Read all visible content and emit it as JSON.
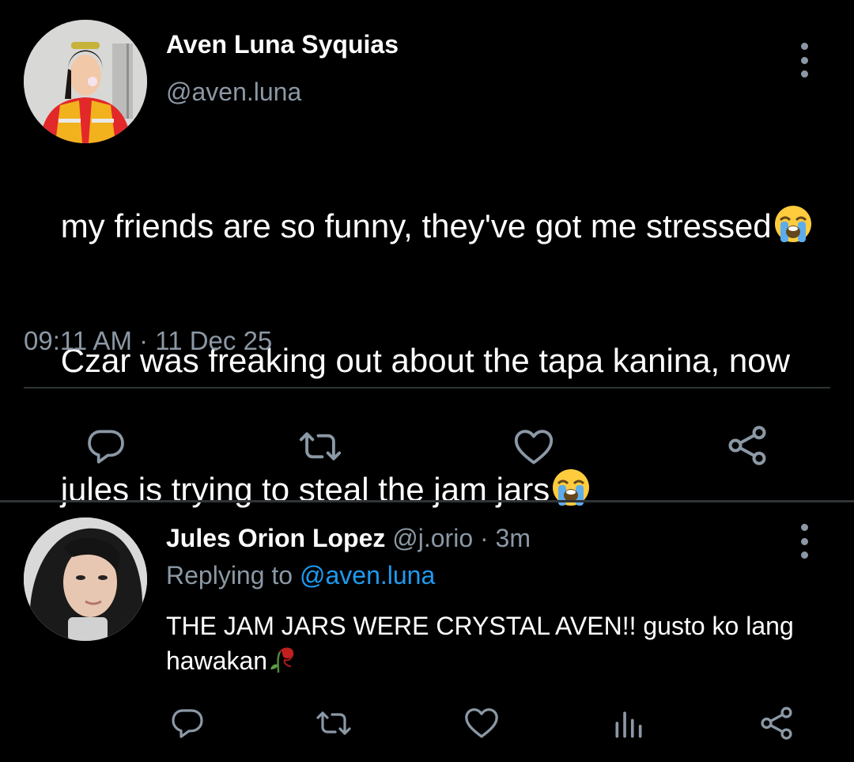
{
  "tweet": {
    "author_name": "Aven Luna Syquias",
    "author_handle": "@aven.luna",
    "line1": "my friends are so funny, they've got me stressed",
    "line2": "Czar was freaking out about the tapa kanina, now",
    "line3": "jules is trying to steal the jam jars",
    "emoji": "loudly-crying-face",
    "timestamp": "09:11 AM · 11 Dec 25"
  },
  "tweet_actions": [
    "reply-icon",
    "retweet-icon",
    "like-icon",
    "share-icon"
  ],
  "reply": {
    "author_name": "Jules Orion Lopez",
    "meta": "@j.orio · 3m",
    "replying_prefix": "Replying to",
    "replying_mention": "@aven.luna",
    "text": "THE JAM JARS WERE CRYSTAL AVEN!! gusto ko lang hawakan",
    "emoji": "wilted-flower"
  },
  "reply_actions": [
    "reply-icon",
    "retweet-icon",
    "like-icon",
    "analytics-icon",
    "share-icon"
  ],
  "colors": {
    "background": "#000000",
    "primary_text": "#ffffff",
    "secondary_text": "#8b98a5",
    "link": "#1d9bf0",
    "divider": "#2f3336"
  }
}
